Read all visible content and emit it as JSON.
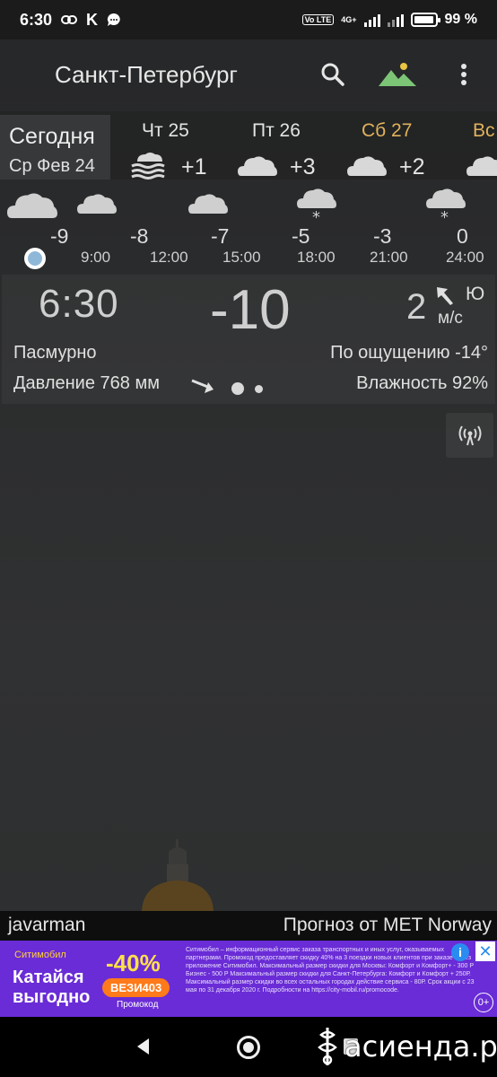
{
  "status_bar": {
    "time": "6:30",
    "k_label": "K",
    "network": "4G+",
    "lte": "Vo LTE",
    "battery": "99 %"
  },
  "app_bar": {
    "city": "Санкт-Петербург",
    "icons": [
      "search-icon",
      "landscape-icon",
      "more-vert-icon"
    ]
  },
  "days": {
    "today": {
      "label": "Сегодня",
      "date": "Ср Фев 24"
    },
    "items": [
      {
        "name": "Чт 25",
        "temp": "+1",
        "icon": "fog-icon",
        "color": "#e3e3e3"
      },
      {
        "name": "Пт 26",
        "temp": "+3",
        "icon": "cloud-icon",
        "color": "#e3e3e3"
      },
      {
        "name": "Сб 27",
        "temp": "+2",
        "icon": "cloud-icon",
        "color": "#e0b25c"
      },
      {
        "name": "Вс",
        "temp": "",
        "icon": "cloud-icon",
        "color": "#e0b25c"
      }
    ]
  },
  "hourly": {
    "temps": [
      "-9",
      "-8",
      "-7",
      "-5",
      "-3",
      "0"
    ],
    "times": [
      "9:00",
      "12:00",
      "15:00",
      "18:00",
      "21:00",
      "24:00"
    ]
  },
  "current": {
    "time": "6:30",
    "temp": "-10",
    "wind_speed": "2",
    "wind_dir": "Ю",
    "wind_unit": "м/с",
    "condition": "Пасмурно",
    "feels_like": "По ощущению -14°",
    "pressure": "Давление 768 мм",
    "humidity": "Влажность 92%"
  },
  "footer": {
    "user": "javarman",
    "source": "Прогноз от MET Norway"
  },
  "ad": {
    "brand": "Ситимобил",
    "slogan": "Катайся выгодно",
    "discount": "-40%",
    "promo_code": "ВЕЗИ403",
    "promo_label": "Промокод",
    "fine_print": "Ситимобил – информационный сервис заказа транспортных и иных услуг, оказываемых партнерами. Промокод предоставляет скидку 40% на 3 поездки новых клиентов при заказе через приложение Ситимобил. Максимальный размер скидки для Москвы: Комфорт и Комфорт+ - 300 Р Бизнес - 500 Р Максимальный размер скидки для Санкт-Петербурга: Комфорт и Комфорт + 250Р. Максимальный размер скидки во всех остальных городах действие сервиса - 80Р. Срок акции с 23 мая по 31 декабря 2020 г. Подробности на https://city-mobil.ru/promocode.",
    "age": "0+",
    "info": "i",
    "close": "✕"
  },
  "watermark": "асиенда.ру"
}
